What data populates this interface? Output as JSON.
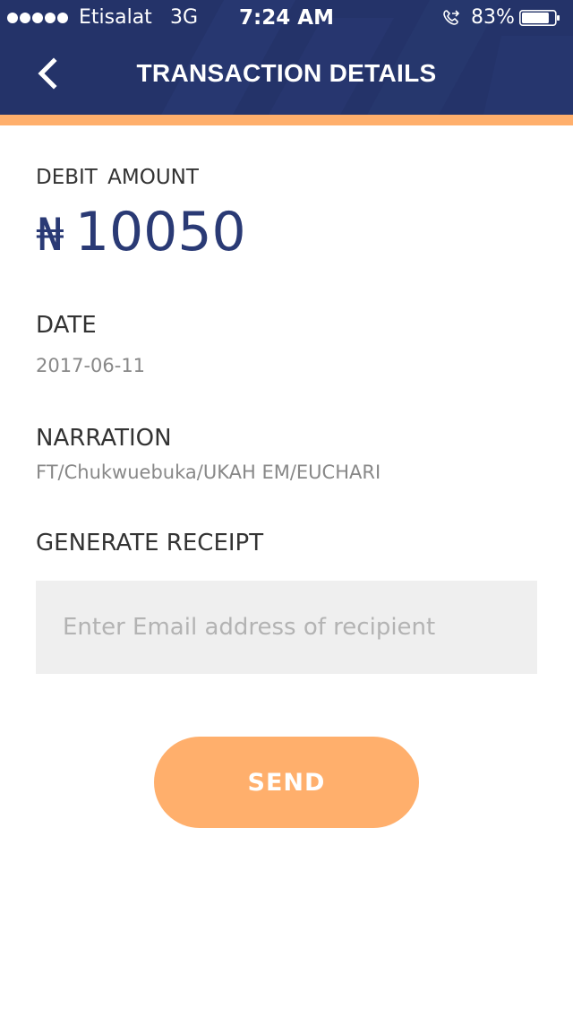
{
  "status_bar": {
    "carrier": "Etisalat",
    "network": "3G",
    "time": "7:24 AM",
    "battery_percent": "83%",
    "signal_dots": 5,
    "battery_level": 0.83
  },
  "header": {
    "title": "TRANSACTION DETAILS",
    "back_icon": "chevron-left-icon"
  },
  "transaction": {
    "debit_label": "DEBIT AMOUNT",
    "currency_symbol": "₦",
    "amount": "10050",
    "date_label": "DATE",
    "date_value": "2017-06-11",
    "narration_label": "NARRATION",
    "narration_value": "FT/Chukwuebuka/UKAH EM/EUCHARI"
  },
  "receipt": {
    "label": "GENERATE RECEIPT",
    "email_placeholder": "Enter Email address of recipient",
    "email_value": "",
    "send_label": "SEND"
  },
  "colors": {
    "header_bg": "#243369",
    "accent": "#ffaf6c",
    "amount_text": "#2a3a75",
    "input_bg": "#efefef"
  }
}
